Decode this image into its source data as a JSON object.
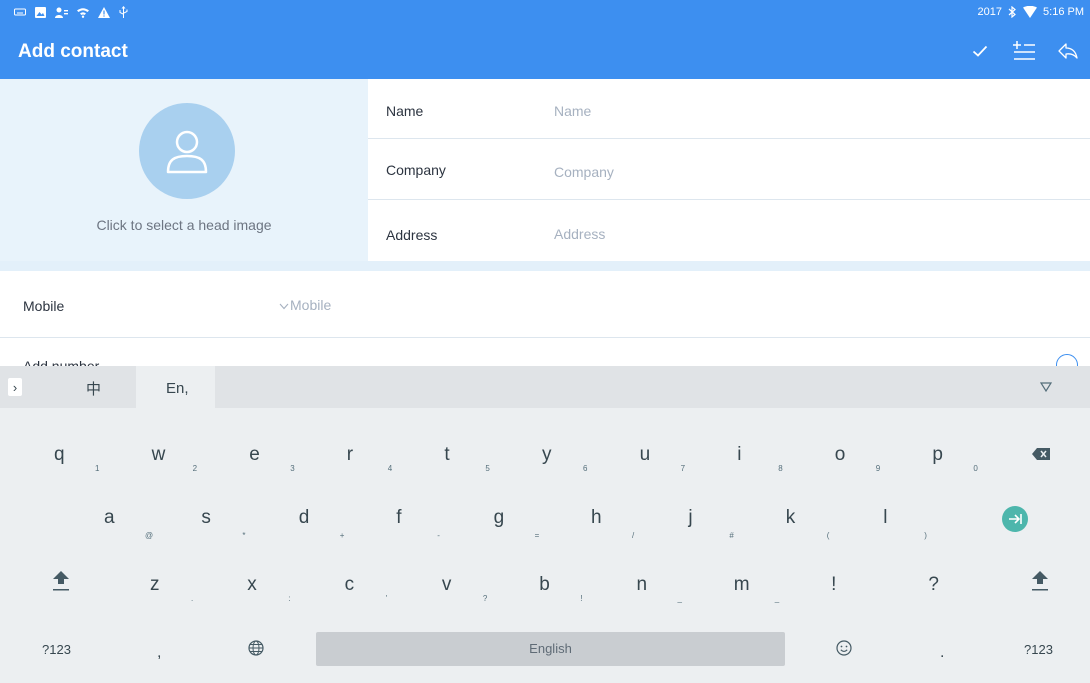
{
  "status_bar": {
    "left_icons": [
      "keyboard-icon",
      "image-icon",
      "person-icon",
      "wifi-icon",
      "warning-icon",
      "usb-icon"
    ],
    "year": "2017",
    "time": "5:16 PM"
  },
  "app_bar": {
    "title": "Add contact",
    "actions": [
      "check-icon",
      "add-field-icon",
      "back-icon"
    ],
    "color": "#3d8ff0"
  },
  "avatar": {
    "caption": "Click to select a head image"
  },
  "fields": [
    {
      "label": "Name",
      "placeholder": "Name"
    },
    {
      "label": "Company",
      "placeholder": "Company"
    },
    {
      "label": "Address",
      "placeholder": "Address"
    }
  ],
  "phone": {
    "label": "Mobile",
    "type": "Mobile",
    "add_label": "Add number"
  },
  "keyboard": {
    "tab_zh": "中",
    "tab_en": "En,",
    "row1": [
      {
        "k": "q",
        "s": "1"
      },
      {
        "k": "w",
        "s": "2"
      },
      {
        "k": "e",
        "s": "3"
      },
      {
        "k": "r",
        "s": "4"
      },
      {
        "k": "t",
        "s": "5"
      },
      {
        "k": "y",
        "s": "6"
      },
      {
        "k": "u",
        "s": "7"
      },
      {
        "k": "i",
        "s": "8"
      },
      {
        "k": "o",
        "s": "9"
      },
      {
        "k": "p",
        "s": "0"
      }
    ],
    "row2": [
      {
        "k": "a",
        "s": "@"
      },
      {
        "k": "s",
        "s": "*"
      },
      {
        "k": "d",
        "s": "+"
      },
      {
        "k": "f",
        "s": "-"
      },
      {
        "k": "g",
        "s": "="
      },
      {
        "k": "h",
        "s": "/"
      },
      {
        "k": "j",
        "s": "#"
      },
      {
        "k": "k",
        "s": "("
      },
      {
        "k": "l",
        "s": ")"
      }
    ],
    "row3": [
      {
        "k": "z",
        "s": "."
      },
      {
        "k": "x",
        "s": ":"
      },
      {
        "k": "c",
        "s": "'"
      },
      {
        "k": "v",
        "s": "?"
      },
      {
        "k": "b",
        "s": "!"
      },
      {
        "k": "n",
        "s": "_"
      },
      {
        "k": "m",
        "s": "_"
      },
      {
        "k": "!",
        "s": ""
      },
      {
        "k": "?",
        "s": ""
      }
    ],
    "left_123": "?123",
    "comma": ",",
    "space": "English",
    "period": ".",
    "right_123": "?123",
    "enter_color": "#4db6ac"
  }
}
